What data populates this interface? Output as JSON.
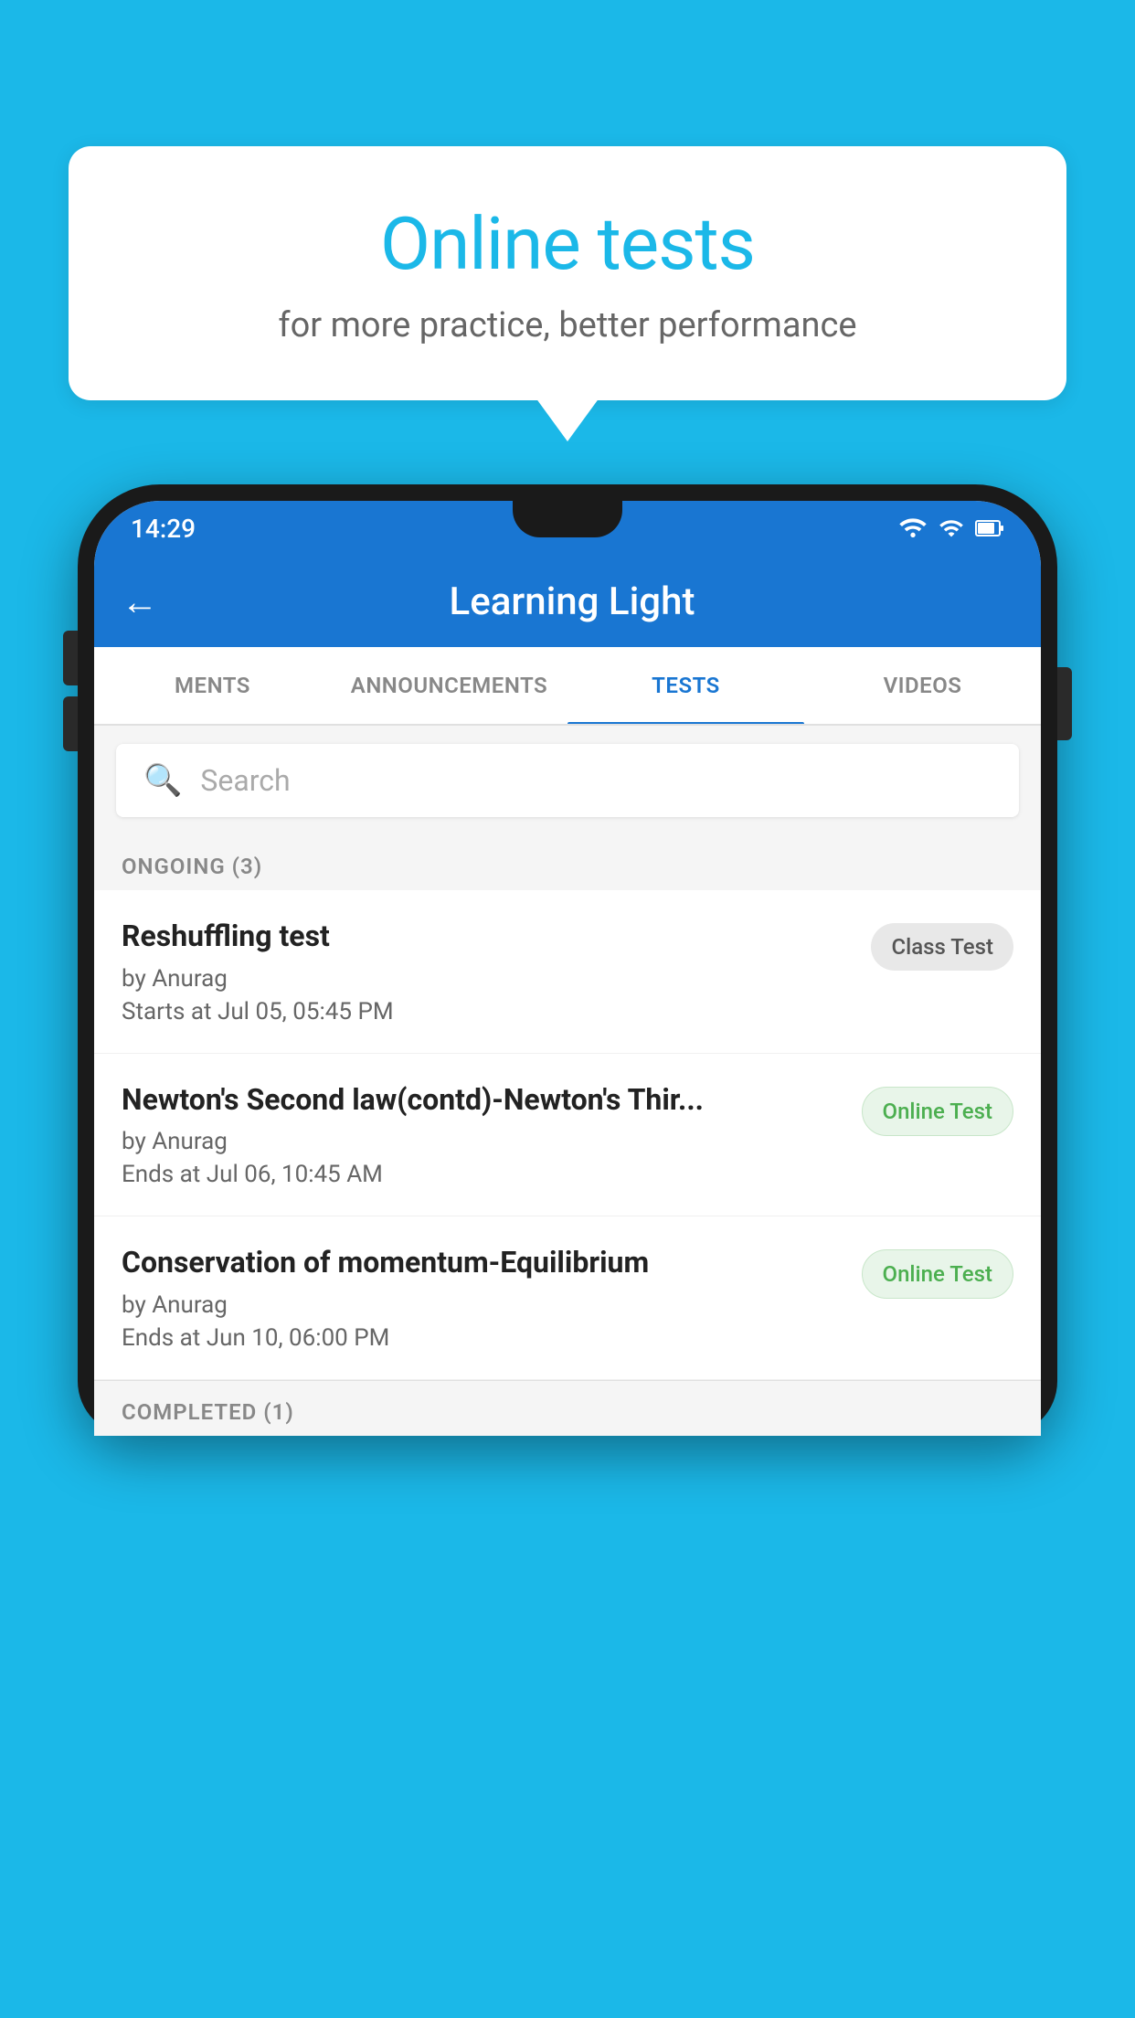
{
  "background": {
    "color": "#1BB8E8"
  },
  "speech_bubble": {
    "title": "Online tests",
    "subtitle": "for more practice, better performance"
  },
  "phone": {
    "status_bar": {
      "time": "14:29",
      "icons": [
        "wifi",
        "signal",
        "battery"
      ]
    },
    "app_bar": {
      "back_label": "←",
      "title": "Learning Light"
    },
    "tabs": [
      {
        "label": "MENTS",
        "active": false
      },
      {
        "label": "ANNOUNCEMENTS",
        "active": false
      },
      {
        "label": "TESTS",
        "active": true
      },
      {
        "label": "VIDEOS",
        "active": false
      }
    ],
    "search": {
      "placeholder": "Search"
    },
    "ongoing_section": {
      "label": "ONGOING (3)"
    },
    "tests": [
      {
        "name": "Reshuffling test",
        "by": "by Anurag",
        "date": "Starts at  Jul 05, 05:45 PM",
        "badge": "Class Test",
        "badge_type": "class"
      },
      {
        "name": "Newton's Second law(contd)-Newton's Thir...",
        "by": "by Anurag",
        "date": "Ends at  Jul 06, 10:45 AM",
        "badge": "Online Test",
        "badge_type": "online"
      },
      {
        "name": "Conservation of momentum-Equilibrium",
        "by": "by Anurag",
        "date": "Ends at  Jun 10, 06:00 PM",
        "badge": "Online Test",
        "badge_type": "online"
      }
    ],
    "completed_section": {
      "label": "COMPLETED (1)"
    }
  }
}
